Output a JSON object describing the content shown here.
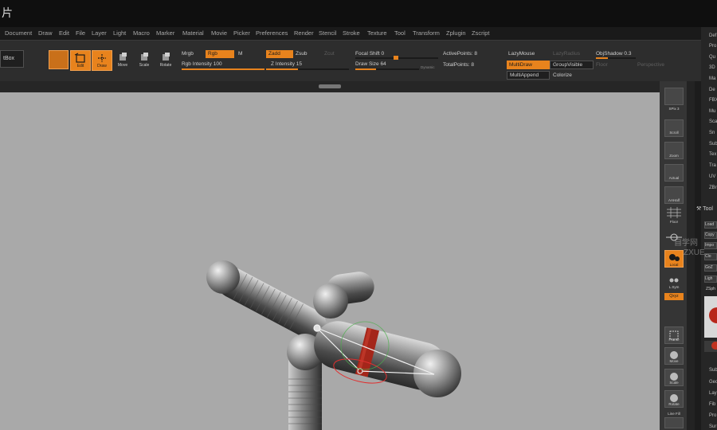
{
  "title_glyph": "片",
  "menu": [
    "Document",
    "Draw",
    "Edit",
    "File",
    "Layer",
    "Light",
    "Macro",
    "Marker",
    "Material",
    "Movie",
    "Picker",
    "Preferences",
    "Render",
    "Stencil",
    "Stroke",
    "Texture",
    "Tool",
    "Transform",
    "Zplugin",
    "Zscript"
  ],
  "shelf": {
    "lightbox": "tBox",
    "modes": {
      "edit": "Edit",
      "draw": "Draw",
      "move": "Move",
      "scale": "Scale",
      "rotate": "Rotate"
    },
    "mrgb": "Mrgb",
    "rgb": "Rgb",
    "m": "M",
    "rgb_intensity": {
      "label": "Rgb Intensity",
      "value": "100"
    },
    "zadd": "Zadd",
    "zsub": "Zsub",
    "zcut": "Zcut",
    "z_intensity": {
      "label": "Z Intensity",
      "value": "15",
      "fraction": 0.15
    },
    "focal_shift": {
      "label": "Focal Shift",
      "value": "0",
      "fraction": 0.5
    },
    "draw_size": {
      "label": "Draw Size",
      "value": "64",
      "fraction": 0.2
    },
    "dynamic": "Dynamic",
    "active_points": {
      "label": "ActivePoints:",
      "value": "8"
    },
    "total_points": {
      "label": "TotalPoints:",
      "value": "8"
    },
    "lazymouse": "LazyMouse",
    "lazyradius": "LazyRadius",
    "multidraw": "MultiDraw",
    "groupvisible": "GroupVisible",
    "multiappend": "MultiAppend",
    "colorize": "Colorize",
    "objshadow": {
      "label": "ObjShadow",
      "value": "0.3"
    },
    "floor": "Floor",
    "fitsp": "FitSp",
    "paint": "Paint",
    "perspective": "Perspective"
  },
  "right_shelf": {
    "spix": "SPix 3",
    "persp": "Persp",
    "floor": "Floor",
    "local": "Local",
    "lsym": "L.Sym",
    "xyz": "Qxyz",
    "frame": "Frame",
    "move": "Move",
    "scale": "Scale",
    "rotate": "Rotate",
    "linefill": "Line Fill",
    "polyf": "PolyF",
    "scroll": "Scroll",
    "zoom": "Zoom",
    "actual": "Actual",
    "aahalf": "AAHalf"
  },
  "tray": [
    "Def",
    "Pro",
    "Qu",
    "3D",
    "Ma",
    "De",
    "FBX",
    "Mu",
    "Sca",
    "Sn",
    "Sub",
    "Tex",
    "Tra",
    "UV",
    "ZBr"
  ],
  "tray_lower": [
    "Sub",
    "Geo",
    "Lay",
    "Fib",
    "Pro",
    "Sur"
  ],
  "tool_palette": {
    "title": "Tool",
    "load": "Load",
    "copy": "Copy",
    "import": "Impo",
    "clone": "Clo",
    "goz": "GoZ",
    "lightbox": "Ligh",
    "zsphere": "ZSph"
  },
  "watermark": {
    "cn": "自学网",
    "en": "ZXUE"
  },
  "colors": {
    "accent": "#e8831d",
    "canvas": "#a9a9a9",
    "panel": "#2d2d2d"
  }
}
